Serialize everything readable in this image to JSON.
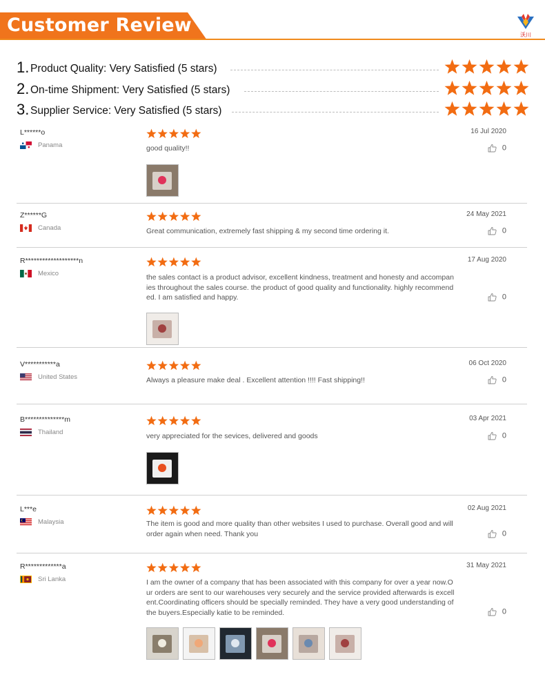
{
  "header": {
    "title": "Customer Review",
    "banner_color": "#f0741c",
    "logo_text": "沃川"
  },
  "summary": [
    {
      "num": "1.",
      "text": "Product Quality: Very Satisfied (5 stars)",
      "stars": 5
    },
    {
      "num": "2.",
      "text": "On-time Shipment: Very Satisfied (5 stars)",
      "stars": 5
    },
    {
      "num": "3.",
      "text": "Supplier Service: Very Satisfied (5 stars)",
      "stars": 5
    }
  ],
  "star_color": "#f26c12",
  "reviews": [
    {
      "name": "L******o",
      "country": "Panama",
      "flag": "panama-flag",
      "rating": 5,
      "date": "16 Jul 2020",
      "comment": "good quality!!",
      "likes": "0",
      "photos": 1
    },
    {
      "name": "Z******G",
      "country": "Canada",
      "flag": "canada-flag",
      "rating": 5,
      "date": "24 May 2021",
      "comment": "Great communication, extremely fast shipping & my second time ordering it.",
      "likes": "0",
      "photos": 0
    },
    {
      "name": "R*******************n",
      "country": "Mexico",
      "flag": "mexico-flag",
      "rating": 5,
      "date": "17 Aug 2020",
      "comment": "the sales contact is a product advisor, excellent kindness, treatment and honesty and accompanies throughout the sales course. the product of good quality and functionality. highly recommended. I am satisfied and happy.",
      "likes": "0",
      "photos": 1
    },
    {
      "name": "V***********a",
      "country": "United States",
      "flag": "usa-flag",
      "rating": 5,
      "date": "06 Oct 2020",
      "comment": "Always a pleasure make deal . Excellent attention !!!! Fast shipping!!",
      "likes": "0",
      "photos": 0
    },
    {
      "name": "B**************m",
      "country": "Thailand",
      "flag": "thailand-flag",
      "rating": 5,
      "date": "03 Apr 2021",
      "comment": "very appreciated for the sevices, delivered and goods",
      "likes": "0",
      "photos": 1
    },
    {
      "name": "L***e",
      "country": "Malaysia",
      "flag": "malaysia-flag",
      "rating": 5,
      "date": "02 Aug 2021",
      "comment": "The item is good and more quality than other websites I used to purchase. Overall good and will order again when need. Thank you",
      "likes": "0",
      "photos": 0
    },
    {
      "name": "R*************a",
      "country": "Sri Lanka",
      "flag": "srilanka-flag",
      "rating": 5,
      "date": "31 May 2021",
      "comment": "I am the owner of a company that has been associated with this company for over a year now.Our orders are sent to our warehouses very securely and the service provided afterwards is excellent.Coordinating officers should be specially reminded. They have a very good understanding of the buyers.Especially katie to be reminded.",
      "likes": "0",
      "photos": 6
    }
  ]
}
